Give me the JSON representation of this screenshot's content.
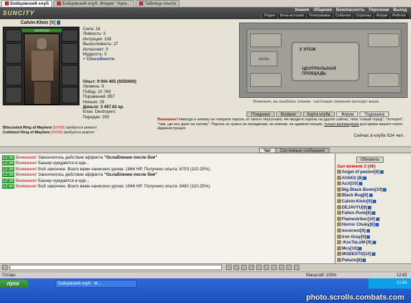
{
  "browser": {
    "tabs": [
      {
        "label": "Бойцовский клуб",
        "active": true
      },
      {
        "label": "Бойцовский клуб. Форум: \"Ауко...",
        "active": false
      },
      {
        "label": "Таблица опыта",
        "active": false
      }
    ]
  },
  "header": {
    "logo": "SUNCITY",
    "menu": [
      "Знания",
      "Общение",
      "Безопасность",
      "Персонаж",
      "Выход"
    ],
    "submenu": [
      "Радио",
      "Бень-история",
      "Телеграммы",
      "События",
      "Скроллы",
      "Форум",
      "Рейтинг"
    ]
  },
  "character": {
    "name": "Calvin-Klein",
    "level": "[9]",
    "hp": "1212/1212",
    "stats": {
      "strength": "Сила: 16",
      "agility": "Ловкость: 3",
      "intuition": "Интуиция: 108",
      "endurance": "Выносливость: 27",
      "intellect": "Интеллект: 0",
      "wisdom": "Мудрость: 0",
      "abilities": "+ Способности"
    },
    "info": {
      "exp": "Опыт: 9 004 405 (9250000)",
      "level": "Уровень: 9",
      "wins": "Побед: 10 769",
      "losses": "Поражений: 857",
      "draws": "Ничьих: 28",
      "money": "Деньги: 3 457.62 кр.",
      "clan": "Клан: Destroyers",
      "transfers": "Передач: 200"
    },
    "rings": [
      {
        "name": "Bitecooled Ring of Mayhem",
        "durability": "[56/58]",
        "note": "требуется ремонт"
      },
      {
        "name": "Coldsteel Ring of Mayhem",
        "durability": "[56/58]",
        "note": "требуется ремонт"
      }
    ]
  },
  "map": {
    "floor": "2 ЭТАЖ",
    "hall": "ЦЕНТРАЛЬНАЯ ПЛОЩАДЬ",
    "halls": "ЗАЛЫ",
    "caption": "Возможно, вы ошиблись этажом - настоящие сражения проходят выше."
  },
  "nav_buttons": [
    "Поединки",
    "Возврат",
    "Карта клуба",
    "Форум",
    "Подсказка"
  ],
  "warning": {
    "label": "Внимание!",
    "text": "Никогда и никому не говорите пароль от своего персонажа. Не вводите пароль на других сайтах, типа \"новый город\", \"лотерея\", \"там, где все дают на халяву\". Пароль не нужен ни паладинам, ни кланам, ни администрации,",
    "link": "только взломщикам",
    "tail": "для кражи вашего героя. Администрация."
  },
  "online": "Сейчас в клубе 924 чел.",
  "chat_tabs": [
    "Чат",
    "Системные сообщения"
  ],
  "chat": [
    {
      "time": "12:38",
      "warn": "Внимание!",
      "text": "Закончилось действие эффекта",
      "bold": "\"Ослабление после боя\""
    },
    {
      "time": "12:38",
      "warn": "Внимание!",
      "text": "Башер нуждается в еде...",
      "bold": ""
    },
    {
      "time": "12:38",
      "warn": "Внимание!",
      "text": "Бой закончен. Всего вами нанесено урона: 1866 HP. Получено опыта: 6703 (110.25%).",
      "bold": ""
    },
    {
      "time": "12:39",
      "warn": "Внимание!",
      "text": "Закончилось действие эффекта",
      "bold": "\"Ослабление после боя\""
    },
    {
      "time": "12:38",
      "warn": "Внимание!",
      "text": "Башер нуждается в еде...",
      "bold": ""
    },
    {
      "time": "12:40",
      "warn": "Внимание!",
      "text": "Бой закончен. Всего вами нанесено урона: 1946 HP. Получено опыта: 8482 (110.25%).",
      "bold": ""
    }
  ],
  "players": {
    "refresh": "Обновить",
    "header": "Зал воинов 3 (46)",
    "list": [
      "Angel of pasion[8]",
      "AYAKS [8]",
      "Azzi[10]",
      "Big Black Boots[10]",
      "Black Bug[8]",
      "Calvin-Klein[9]",
      "DEJAVYU[8]",
      "Fallen Punk[8]",
      "Flamestriker[10]",
      "Horror Chuky[8]",
      "incorrect[9]",
      "Iren Gray[9]",
      "-KocTaLoM-[9]",
      "Mcs[10]",
      "MODESTO[10]",
      "Palazio[8]"
    ]
  },
  "statusbar": {
    "left": "Готово",
    "mid": "Масштаб: 100%",
    "right": "12:43"
  },
  "taskbar": {
    "start": "пуск",
    "task": "Бойцовский клуб - М...",
    "clock": "12:43"
  },
  "watermark": "photo.scrolls.combats.com"
}
